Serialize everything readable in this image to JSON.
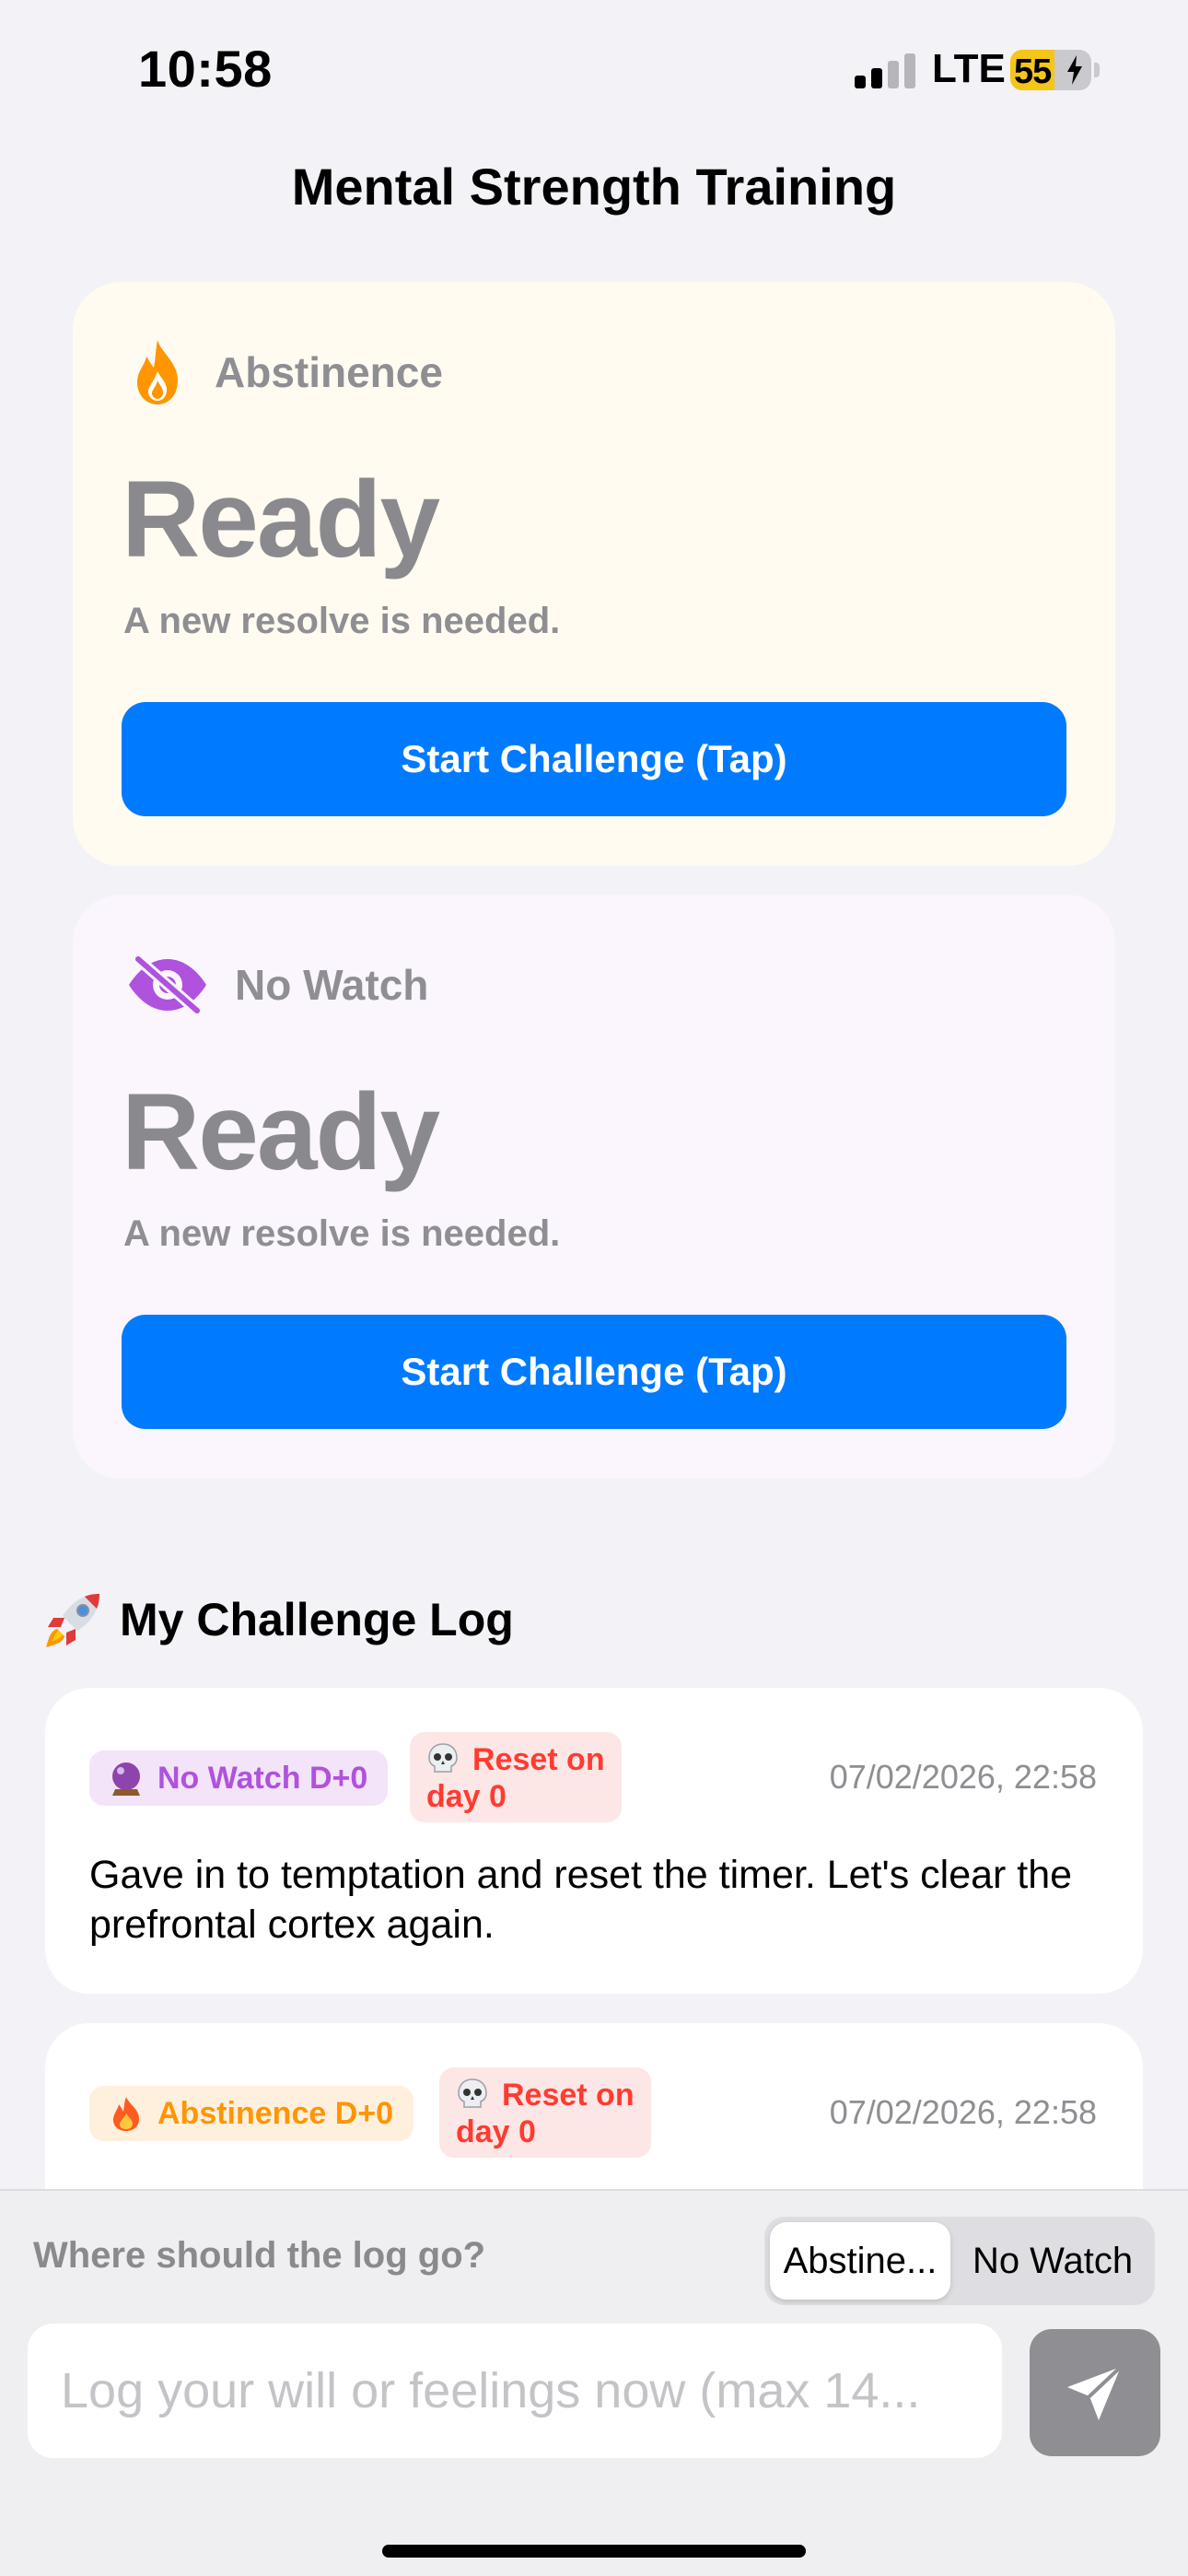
{
  "status_bar": {
    "time": "10:58",
    "network": "LTE",
    "battery": "55"
  },
  "nav": {
    "title": "Mental Strength Training"
  },
  "challenges": [
    {
      "label": "Abstinence",
      "icon": "flame-icon",
      "status": "Ready",
      "subtitle": "A new resolve is needed.",
      "button_label": "Start Challenge (Tap)",
      "card_color": "#fffbf1",
      "accent": "#ff9500"
    },
    {
      "label": "No Watch",
      "icon": "eye-slash-icon",
      "status": "Ready",
      "subtitle": "A new resolve is needed.",
      "button_label": "Start Challenge (Tap)",
      "card_color": "#fbf5fd",
      "accent": "#af52de"
    }
  ],
  "log_section": {
    "title": "My Challenge Log",
    "icon": "rocket-icon",
    "entries": [
      {
        "tag_icon": "crystal-ball-icon",
        "tag": "No Watch D+0",
        "reset_icon": "skull-icon",
        "reset_line1": "Reset on",
        "reset_line2": "day 0",
        "date": "07/02/2026, 22:58",
        "text": "Gave in to temptation and reset the timer. Let's clear the prefrontal cortex again."
      },
      {
        "tag_icon": "fire-icon",
        "tag": "Abstinence D+0",
        "reset_icon": "skull-icon",
        "reset_line1": "Reset on",
        "reset_line2": "day 0",
        "date": "07/02/2026, 22:58"
      }
    ]
  },
  "composer": {
    "destination_label": "Where should the log go?",
    "segments": [
      "Abstine...",
      "No Watch"
    ],
    "selected_segment": "Abstine...",
    "input_placeholder": "Log your will or feelings now (max 14...",
    "input_value": "",
    "send_icon": "paper-plane-icon"
  },
  "colors": {
    "accent_blue": "#007aff",
    "reset_red": "#ff3b30",
    "background": "#f2f2f7"
  }
}
